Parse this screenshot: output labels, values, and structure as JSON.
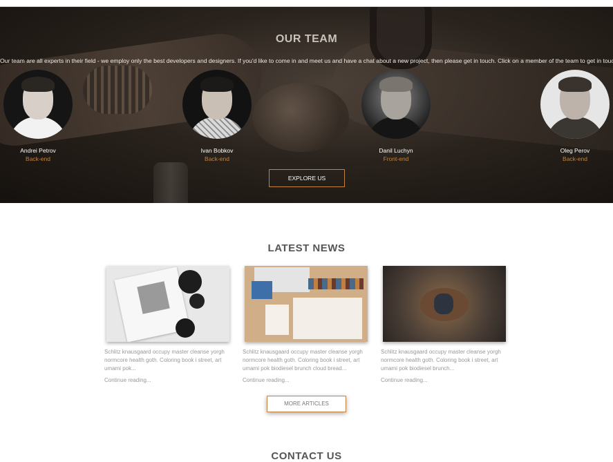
{
  "team": {
    "title": "OUR TEAM",
    "intro": "Our team are all experts in their field - we employ only the best developers and designers. If you'd like to come in and meet us and have a chat about a new project, then please get in touch. Click on a member of the team to get in touch..",
    "members": [
      {
        "name": "Andrei Petrov",
        "role": "Back-end"
      },
      {
        "name": "Ivan Bobkov",
        "role": "Back-end"
      },
      {
        "name": "Danil Luchyn",
        "role": "Front-end"
      },
      {
        "name": "Oleg Perov",
        "role": "Back-end"
      }
    ],
    "explore_label": "EXPLORE US"
  },
  "news": {
    "title": "LATEST NEWS",
    "articles": [
      {
        "excerpt": "Schlitz knausgaard occupy master cleanse yorgh normcore health goth. Coloring book i street, art umami pok...",
        "link": "Continue reading..."
      },
      {
        "excerpt": "Schlitz knausgaard occupy master cleanse yorgh normcore health goth. Coloring book i street, art umami pok biodiesel brunch cloud bread...",
        "link": "Continue reading..."
      },
      {
        "excerpt": "Schlitz knausgaard occupy master cleanse yorgh normcore health goth. Coloring book i street, art umami pok biodiesel brunch...",
        "link": "Continue reading..."
      }
    ],
    "more_label": "MORE ARTICLES"
  },
  "contact": {
    "title": "CONTACT US"
  },
  "colors": {
    "accent": "#c4823c",
    "dark_overlay": "#1e1915",
    "heading": "#555555"
  }
}
